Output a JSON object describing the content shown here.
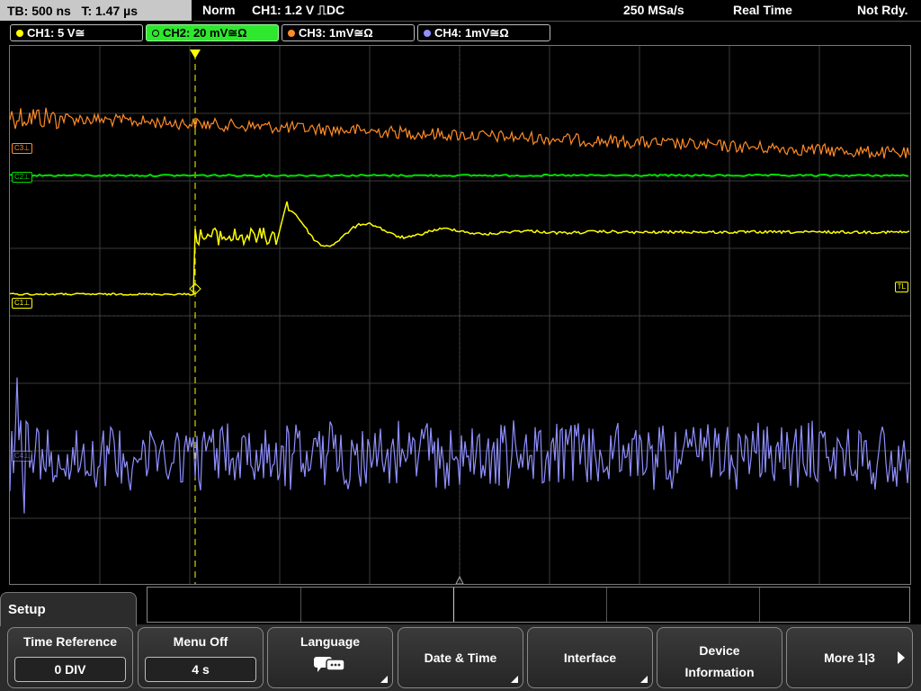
{
  "header": {
    "timebase": "TB: 500 ns   T: 1.47 µs",
    "trigger_mode": "Norm",
    "trigger_info": "CH1: 1.2 V ⎍DC",
    "sample_rate": "250 MSa/s",
    "acq_mode": "Real Time",
    "status": "Not Rdy."
  },
  "channels": [
    {
      "label": "CH1: 5 V≅",
      "color": "#ffff00",
      "active": false
    },
    {
      "label": "CH2: 20 mV≅Ω",
      "color": "#00e000",
      "active": true
    },
    {
      "label": "CH3: 1mV≅Ω",
      "color": "#ff8c28",
      "active": false
    },
    {
      "label": "CH4: 1mV≅Ω",
      "color": "#9090ff",
      "active": false
    }
  ],
  "markers": {
    "c3": "C3⊥",
    "c2": "C2⊥",
    "c1": "C1⊥",
    "c4": "C4⊥",
    "trigger_level": "TL"
  },
  "menu": {
    "title": "Setup",
    "softkeys": [
      {
        "label": "Time Reference",
        "value": "0 DIV"
      },
      {
        "label": "Menu Off",
        "value": "4 s"
      },
      {
        "label": "Language",
        "icon": "speech-bubble-icon"
      },
      {
        "label": "Date & Time"
      },
      {
        "label": "Interface"
      },
      {
        "label": "Device Information"
      },
      {
        "label": "More 1|3"
      }
    ]
  }
}
